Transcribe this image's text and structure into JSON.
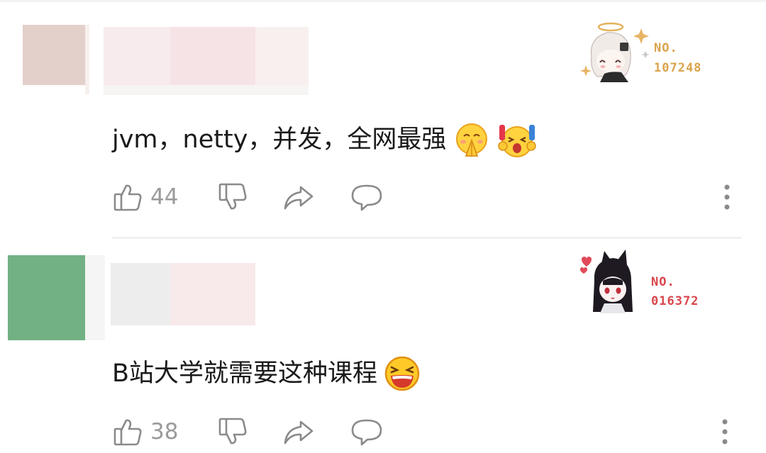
{
  "comments": [
    {
      "text": "jvm，netty，并发，全网最强",
      "emojis": [
        "praying-face-emoji",
        "excited-face-emoji"
      ],
      "likes": "44",
      "badge": {
        "line1": "NO.",
        "line2": "107248",
        "color": "#d9a44c"
      }
    },
    {
      "text": "B站大学就需要这种课程",
      "emojis": [
        "laughing-face-emoji"
      ],
      "likes": "38",
      "badge": {
        "line1": "NO.",
        "line2": "016372",
        "color": "#d9464c"
      }
    }
  ],
  "colors": {
    "avatar1": "#e3d0cb",
    "avatar2": "#72b184",
    "icon": "#8a8a8a"
  }
}
